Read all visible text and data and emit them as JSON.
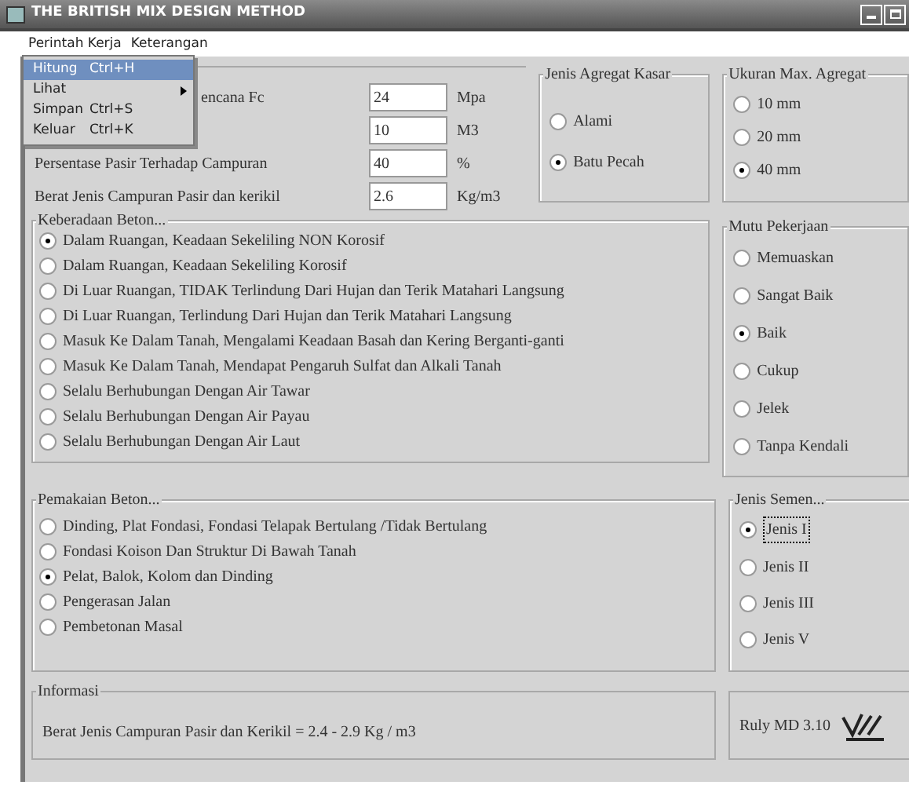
{
  "window": {
    "title": "THE BRITISH MIX DESIGN METHOD"
  },
  "menu": [
    {
      "label": "Perintah Kerja"
    },
    {
      "label": "Keterangan"
    }
  ],
  "dropdown": [
    {
      "label": "Hitung",
      "shortcut": "Ctrl+H",
      "selected": true,
      "submenu": false
    },
    {
      "label": "Lihat",
      "selected": false,
      "submenu": true
    },
    {
      "label": "Simpan",
      "shortcut": "Ctrl+S",
      "selected": false,
      "submenu": false
    },
    {
      "label": "Keluar",
      "shortcut": "Ctrl+K",
      "selected": false,
      "submenu": false
    }
  ],
  "inputs": [
    {
      "label": "encana Fc",
      "cut": true,
      "value": "24",
      "unit": "Mpa"
    },
    {
      "value": "10",
      "unit": "M3"
    },
    {
      "label": "Persentase Pasir Terhadap Campuran",
      "cut": false,
      "value": "40",
      "unit": "%"
    },
    {
      "label": "Berat Jenis Campuran Pasir dan kerikil",
      "cut": false,
      "value": "2.6",
      "unit": "Kg/m3"
    }
  ],
  "agregat": {
    "title": "Jenis Agregat Kasar",
    "options": [
      {
        "label": "Alami",
        "selected": false
      },
      {
        "label": "Batu Pecah",
        "selected": true
      }
    ]
  },
  "ukuran": {
    "title": "Ukuran Max. Agregat",
    "options": [
      {
        "label": "10 mm",
        "selected": false
      },
      {
        "label": "20 mm",
        "selected": false
      },
      {
        "label": "40 mm",
        "selected": true
      }
    ]
  },
  "keberadaan": {
    "title": "Keberadaan Beton...",
    "options": [
      {
        "label": "Dalam Ruangan, Keadaan Sekeliling NON Korosif",
        "selected": true
      },
      {
        "label": "Dalam Ruangan, Keadaan Sekeliling Korosif",
        "selected": false
      },
      {
        "label": "Di Luar Ruangan, TIDAK Terlindung Dari Hujan dan Terik Matahari Langsung",
        "selected": false
      },
      {
        "label": "Di Luar Ruangan, Terlindung Dari Hujan dan Terik Matahari Langsung",
        "selected": false
      },
      {
        "label": "Masuk Ke Dalam Tanah, Mengalami Keadaan Basah dan Kering Berganti-ganti",
        "selected": false
      },
      {
        "label": "Masuk Ke Dalam Tanah, Mendapat Pengaruh Sulfat dan Alkali Tanah",
        "selected": false
      },
      {
        "label": "Selalu Berhubungan Dengan Air Tawar",
        "selected": false
      },
      {
        "label": "Selalu Berhubungan Dengan Air Payau",
        "selected": false
      },
      {
        "label": "Selalu Berhubungan Dengan Air Laut",
        "selected": false
      }
    ]
  },
  "mutu": {
    "title": "Mutu Pekerjaan",
    "options": [
      {
        "label": "Memuaskan",
        "selected": false
      },
      {
        "label": "Sangat Baik",
        "selected": false
      },
      {
        "label": "Baik",
        "selected": true
      },
      {
        "label": "Cukup",
        "selected": false
      },
      {
        "label": "Jelek",
        "selected": false
      },
      {
        "label": "Tanpa Kendali",
        "selected": false
      }
    ]
  },
  "pemakaian": {
    "title": "Pemakaian Beton...",
    "options": [
      {
        "label": "Dinding, Plat Fondasi, Fondasi Telapak Bertulang /Tidak Bertulang",
        "selected": false
      },
      {
        "label": "Fondasi Koison Dan Struktur Di Bawah Tanah",
        "selected": false
      },
      {
        "label": "Pelat, Balok, Kolom dan Dinding",
        "selected": true
      },
      {
        "label": "Pengerasan Jalan",
        "selected": false
      },
      {
        "label": "Pembetonan Masal",
        "selected": false
      }
    ]
  },
  "semen": {
    "title": "Jenis Semen...",
    "options": [
      {
        "label": "Jenis I",
        "selected": true
      },
      {
        "label": "Jenis II",
        "selected": false
      },
      {
        "label": "Jenis III",
        "selected": false
      },
      {
        "label": "Jenis V",
        "selected": false
      }
    ]
  },
  "informasi": {
    "title": "Informasi",
    "text": "Berat Jenis Campuran Pasir dan Kerikil = 2.4 - 2.9 Kg / m3"
  },
  "version": "Ruly MD 3.10"
}
